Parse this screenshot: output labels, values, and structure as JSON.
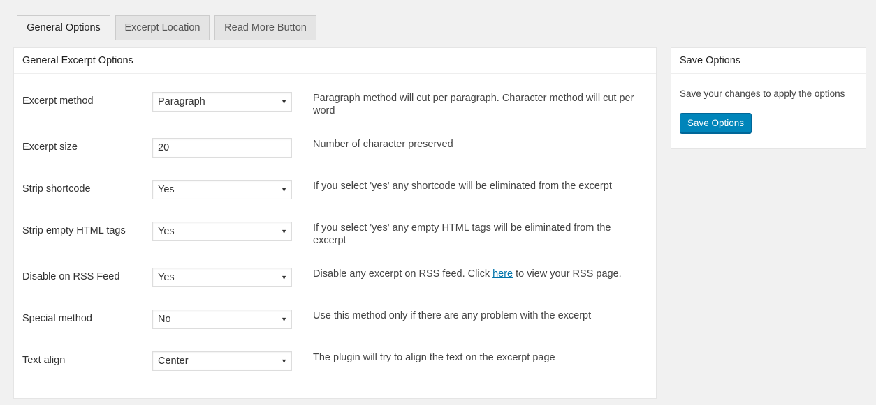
{
  "tabs": [
    {
      "label": "General Options",
      "active": true
    },
    {
      "label": "Excerpt Location",
      "active": false
    },
    {
      "label": "Read More Button",
      "active": false
    }
  ],
  "main": {
    "title": "General Excerpt Options",
    "rows": [
      {
        "label": "Excerpt method",
        "type": "select",
        "value": "Paragraph",
        "desc": "Paragraph method will cut per paragraph. Character method will cut per word"
      },
      {
        "label": "Excerpt size",
        "type": "input",
        "value": "20",
        "desc": "Number of character preserved"
      },
      {
        "label": "Strip shortcode",
        "type": "select",
        "value": "Yes",
        "desc": "If you select 'yes' any shortcode will be eliminated from the excerpt"
      },
      {
        "label": "Strip empty HTML tags",
        "type": "select",
        "value": "Yes",
        "desc": "If you select 'yes' any empty HTML tags will be eliminated from the excerpt"
      },
      {
        "label": "Disable on RSS Feed",
        "type": "select",
        "value": "Yes",
        "desc_before": "Disable any excerpt on RSS feed. Click ",
        "desc_link": "here",
        "desc_after": " to view your RSS page."
      },
      {
        "label": "Special method",
        "type": "select",
        "value": "No",
        "desc": "Use this method only if there are any problem with the excerpt"
      },
      {
        "label": "Text align",
        "type": "select",
        "value": "Center",
        "desc": "The plugin will try to align the text on the excerpt page"
      }
    ]
  },
  "side": {
    "title": "Save Options",
    "text": "Save your changes to apply the options",
    "button_label": "Save Options"
  },
  "colors": {
    "primary_button": "#0085ba",
    "link": "#0073aa"
  },
  "icons": {
    "select_arrow": "dropdown-arrow-icon"
  }
}
